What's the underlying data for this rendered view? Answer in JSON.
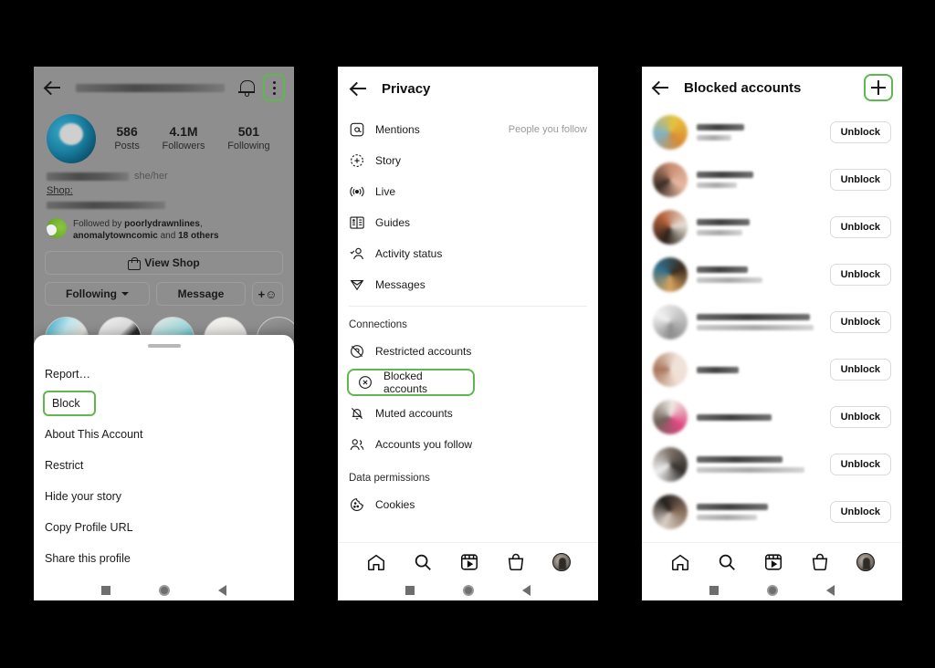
{
  "panel1": {
    "name": "instagram-profile-screen",
    "topbar": {
      "back_icon": "back-arrow-icon",
      "username_redacted": "",
      "bell_icon": "notifications-bell-icon",
      "menu_icon": "kebab-menu-icon"
    },
    "stats": [
      {
        "num": "586",
        "label": "Posts"
      },
      {
        "num": "4.1M",
        "label": "Followers"
      },
      {
        "num": "501",
        "label": "Following"
      }
    ],
    "bio": {
      "pronouns": "she/her",
      "shop_label": "Shop:"
    },
    "followed_by": {
      "prefix": "Followed by ",
      "name1": "poorlydrawnlines",
      "sep": ", ",
      "name2": "anomalytowncomic",
      "suffix": " and",
      "more": "18 others"
    },
    "buttons": {
      "view_shop": "View Shop",
      "following": "Following",
      "message": "Message",
      "add_person": "add-person-icon"
    },
    "sheet": {
      "items": [
        {
          "label": "Report…",
          "highlighted": false
        },
        {
          "label": "Block",
          "highlighted": true
        },
        {
          "label": "About This Account",
          "highlighted": false
        },
        {
          "label": "Restrict",
          "highlighted": false
        },
        {
          "label": "Hide your story",
          "highlighted": false
        },
        {
          "label": "Copy Profile URL",
          "highlighted": false
        },
        {
          "label": "Share this profile",
          "highlighted": false
        }
      ]
    }
  },
  "panel2": {
    "name": "privacy-settings-screen",
    "title": "Privacy",
    "rows": [
      {
        "label": "Mentions",
        "icon": "at-mention-icon",
        "value": "People you follow",
        "highlighted": false
      },
      {
        "label": "Story",
        "icon": "story-plus-icon",
        "value": "",
        "highlighted": false
      },
      {
        "label": "Live",
        "icon": "live-broadcast-icon",
        "value": "",
        "highlighted": false
      },
      {
        "label": "Guides",
        "icon": "guides-book-icon",
        "value": "",
        "highlighted": false
      },
      {
        "label": "Activity status",
        "icon": "activity-status-person-icon",
        "value": "",
        "highlighted": false
      },
      {
        "label": "Messages",
        "icon": "messages-paper-plane-icon",
        "value": "",
        "highlighted": false
      }
    ],
    "section_connections": "Connections",
    "connections": [
      {
        "label": "Restricted accounts",
        "icon": "restricted-accounts-icon",
        "highlighted": false
      },
      {
        "label": "Blocked accounts",
        "icon": "blocked-accounts-x-circle-icon",
        "highlighted": true
      },
      {
        "label": "Muted accounts",
        "icon": "muted-bell-icon",
        "highlighted": false
      },
      {
        "label": "Accounts you follow",
        "icon": "accounts-you-follow-icon",
        "highlighted": false
      }
    ],
    "section_data": "Data permissions",
    "data_permissions": [
      {
        "label": "Cookies",
        "icon": "cookie-icon",
        "highlighted": false
      }
    ]
  },
  "panel3": {
    "name": "blocked-accounts-screen",
    "title": "Blocked accounts",
    "add_icon": "plus-add-icon",
    "unblock_label": "Unblock",
    "rows": [
      {
        "avatar": "av-a",
        "name_w": 52,
        "sub_w": 38,
        "has_sub": true
      },
      {
        "avatar": "av-b",
        "name_w": 62,
        "sub_w": 44,
        "has_sub": true
      },
      {
        "avatar": "av-c",
        "name_w": 58,
        "sub_w": 50,
        "has_sub": true
      },
      {
        "avatar": "av-d",
        "name_w": 56,
        "sub_w": 72,
        "has_sub": true
      },
      {
        "avatar": "av-e",
        "name_w": 124,
        "sub_w": 128,
        "has_sub": true
      },
      {
        "avatar": "av-f",
        "name_w": 46,
        "sub_w": 0,
        "has_sub": false
      },
      {
        "avatar": "av-g",
        "name_w": 82,
        "sub_w": 0,
        "has_sub": false
      },
      {
        "avatar": "av-h",
        "name_w": 94,
        "sub_w": 118,
        "has_sub": true
      },
      {
        "avatar": "av-i",
        "name_w": 78,
        "sub_w": 66,
        "has_sub": true
      }
    ]
  },
  "tabbar": {
    "items": [
      {
        "icon": "home-icon",
        "name": "tab-home"
      },
      {
        "icon": "search-icon",
        "name": "tab-search"
      },
      {
        "icon": "reels-icon",
        "name": "tab-reels"
      },
      {
        "icon": "shop-bag-icon",
        "name": "tab-shop"
      },
      {
        "icon": "profile-avatar-icon",
        "name": "tab-profile"
      }
    ]
  },
  "android_nav": {
    "items": [
      {
        "icon": "recents-square-icon",
        "name": "android-recents"
      },
      {
        "icon": "home-circle-icon",
        "name": "android-home"
      },
      {
        "icon": "back-triangle-icon",
        "name": "android-back"
      }
    ]
  },
  "colors": {
    "highlight_green": "#5fb74f",
    "background": "#000000",
    "panel_bg": "#ffffff",
    "dim_overlay": "#8e8e8e"
  }
}
